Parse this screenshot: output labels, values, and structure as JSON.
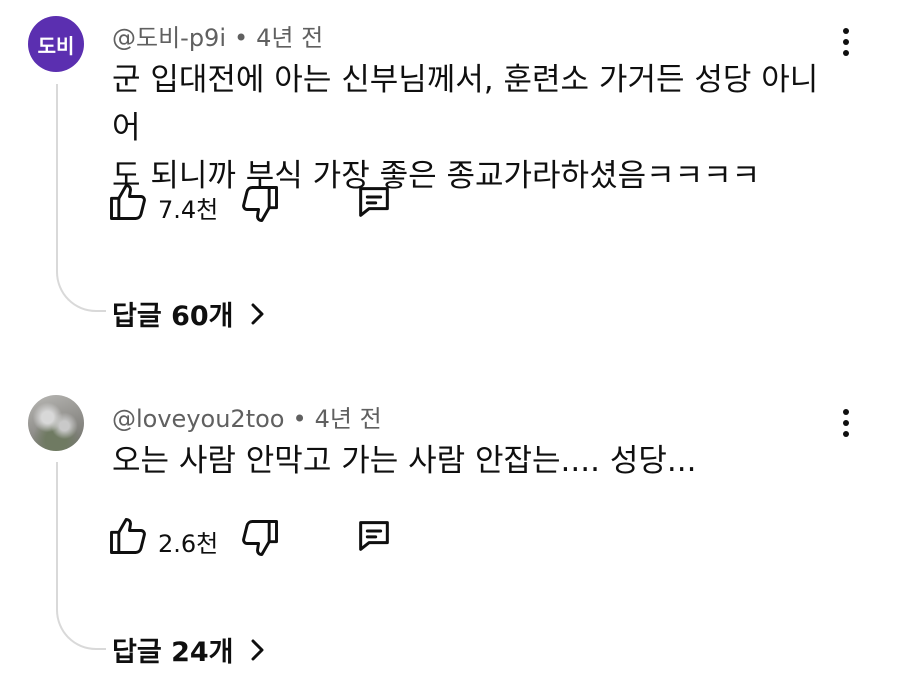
{
  "comments": [
    {
      "avatar_text": "도비",
      "avatar_color": "#5b2fb0",
      "handle": "@도비-p9i",
      "separator": "•",
      "time": "4년 전",
      "lines": [
        "군 입대전에 아는 신부님께서, 훈련소 가거든 성당 아니어",
        "도 되니까 부식 가장 좋은 종교가라하셨음ㅋㅋㅋㅋ"
      ],
      "like_count": "7.4천",
      "replies_label": "답글 60개"
    },
    {
      "avatar_text": "",
      "handle": "@loveyou2too",
      "separator": "•",
      "time": "4년 전",
      "lines": [
        "오는 사람 안막고 가는 사람 안잡는.... 성당..."
      ],
      "like_count": "2.6천",
      "replies_label": "답글 24개"
    }
  ],
  "icons": {
    "like": "thumbs-up-icon",
    "dislike": "thumbs-down-icon",
    "reply": "comment-icon",
    "more": "more-vert-icon",
    "expand": "chevron-right-icon"
  }
}
